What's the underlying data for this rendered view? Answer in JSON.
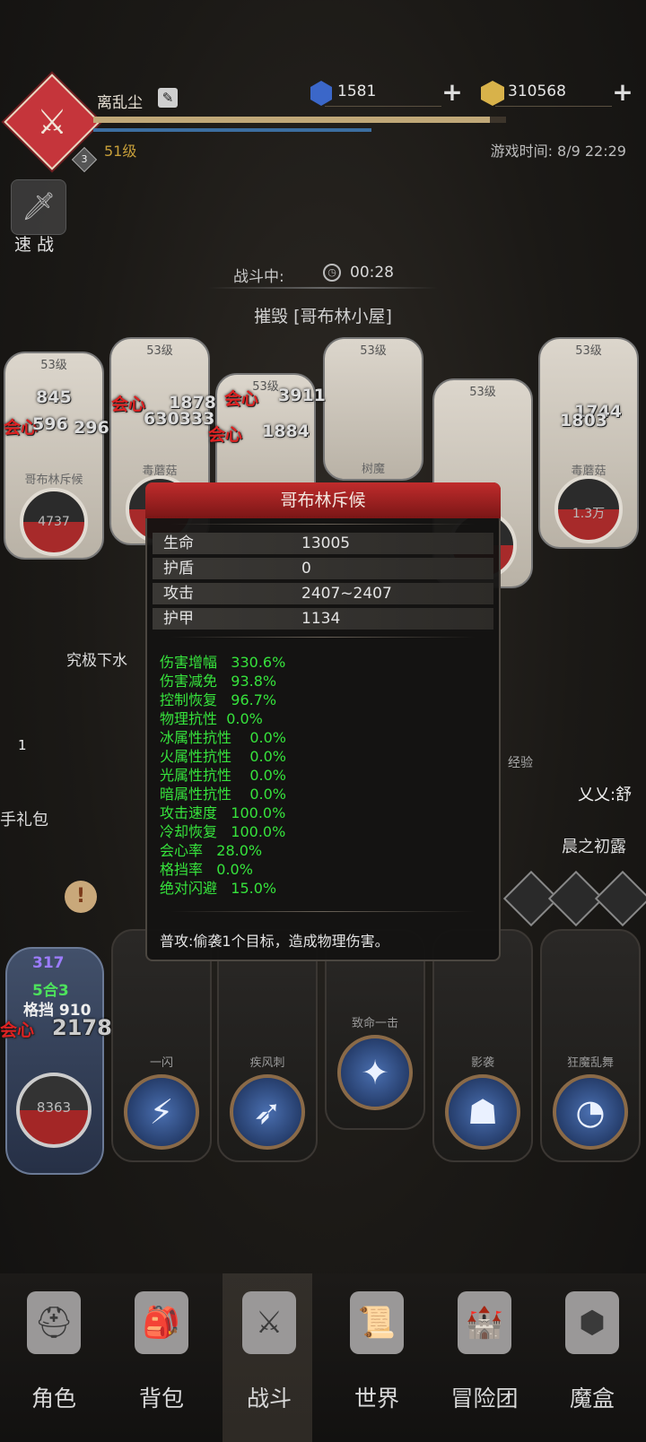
{
  "player": {
    "name": "离乱尘",
    "level": "51级",
    "rank": "3",
    "hp_fraction": 0.96,
    "game_time": "游戏时间: 8/9 22:29"
  },
  "currency": {
    "gems": "1581",
    "gold": "310568"
  },
  "quick_battle": {
    "label": "速 战"
  },
  "battle": {
    "status": "战斗中:",
    "timer": "00:28",
    "objective": "摧毁 [哥布林小屋]"
  },
  "enemies": [
    {
      "level": "53级",
      "name": "哥布林斥候",
      "hp": "4737",
      "damage": [
        "845",
        "596",
        "296"
      ]
    },
    {
      "level": "53级",
      "name": "毒蘑菇",
      "hp": "",
      "damage": [
        "1878",
        "630333"
      ]
    },
    {
      "level": "53级",
      "name": "",
      "hp": "",
      "damage": [
        "3911",
        "1884"
      ]
    },
    {
      "level": "53级",
      "name": "树魔",
      "hp": "",
      "damage": []
    },
    {
      "level": "53级",
      "name": "",
      "hp": "",
      "damage": []
    },
    {
      "level": "53级",
      "name": "毒蘑菇",
      "hp": "1.3万",
      "damage": [
        "1744",
        "1803"
      ]
    }
  ],
  "crit_label": "会心",
  "tooltip": {
    "title": "哥布林斥候",
    "base_stats": [
      {
        "label": "生命",
        "value": "13005"
      },
      {
        "label": "护盾",
        "value": "0"
      },
      {
        "label": "攻击",
        "value": "2407~2407"
      },
      {
        "label": "护甲",
        "value": "1134"
      }
    ],
    "attributes": [
      {
        "label": "伤害增幅",
        "value": "330.6%"
      },
      {
        "label": "伤害减免",
        "value": "93.8%"
      },
      {
        "label": "控制恢复",
        "value": "96.7%"
      },
      {
        "label": "物理抗性",
        "value": "0.0%"
      },
      {
        "label": "冰属性抗性",
        "value": "0.0%"
      },
      {
        "label": "火属性抗性",
        "value": "0.0%"
      },
      {
        "label": "光属性抗性",
        "value": "0.0%"
      },
      {
        "label": "暗属性抗性",
        "value": "0.0%"
      },
      {
        "label": "攻击速度",
        "value": "100.0%"
      },
      {
        "label": "冷却恢复",
        "value": "100.0%"
      },
      {
        "label": "会心率",
        "value": "28.0%"
      },
      {
        "label": "格挡率",
        "value": "0.0%"
      },
      {
        "label": "绝对闪避",
        "value": "15.0%"
      }
    ],
    "description": "普攻:偷袭1个目标，造成物理伤害。"
  },
  "background_text": {
    "t1": "究极下水",
    "t2": "手礼包",
    "t3": "经验",
    "t4": "乂乂:舒",
    "t5": "晨之初露",
    "num": "1"
  },
  "player_card": {
    "hp": "8363",
    "buff": "317",
    "block": "格挡 910",
    "crit": "2178",
    "combo": "5合3"
  },
  "skills": [
    {
      "name": "一闪",
      "icon": "slash-icon"
    },
    {
      "name": "疾风刺",
      "icon": "wind-stab-icon"
    },
    {
      "name": "致命一击",
      "icon": "fatal-strike-icon"
    },
    {
      "name": "影袭",
      "icon": "shadow-raid-icon"
    },
    {
      "name": "狂魔乱舞",
      "icon": "frenzy-icon"
    }
  ],
  "nav": [
    {
      "label": "角色",
      "icon": "helmet-icon"
    },
    {
      "label": "背包",
      "icon": "backpack-icon"
    },
    {
      "label": "战斗",
      "icon": "shield-sword-icon"
    },
    {
      "label": "世界",
      "icon": "scroll-map-icon"
    },
    {
      "label": "冒险团",
      "icon": "castle-icon"
    },
    {
      "label": "魔盒",
      "icon": "magic-box-icon"
    }
  ],
  "colors": {
    "accent_red": "#c02c2c",
    "stat_green": "#36e33c",
    "gold": "#c79f3a"
  }
}
